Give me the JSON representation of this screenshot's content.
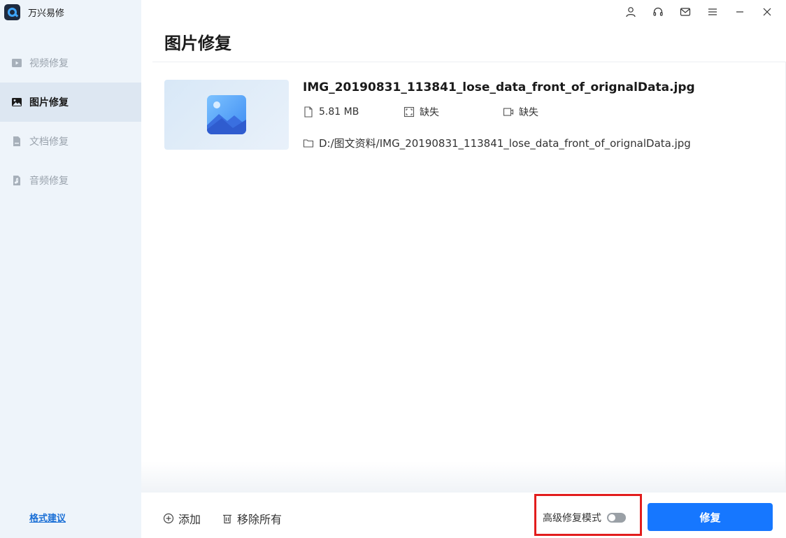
{
  "app": {
    "title": "万兴易修",
    "logo_icon": "app-logo-icon"
  },
  "sidebar": {
    "items": [
      {
        "label": "视频修复",
        "icon": "video-icon",
        "active": false
      },
      {
        "label": "图片修复",
        "icon": "image-icon",
        "active": true
      },
      {
        "label": "文档修复",
        "icon": "document-icon",
        "active": false
      },
      {
        "label": "音频修复",
        "icon": "audio-icon",
        "active": false
      }
    ],
    "format_link": "格式建议"
  },
  "titlebar": {
    "icons": [
      "user-icon",
      "headset-icon",
      "mail-icon",
      "menu-icon",
      "minimize-icon",
      "close-icon"
    ]
  },
  "page": {
    "title": "图片修复"
  },
  "file": {
    "name": "IMG_20190831_113841_lose_data_front_of_orignalData.jpg",
    "size": "5.81  MB",
    "resolution": "缺失",
    "camera": "缺失",
    "path": "D:/图文资料/IMG_20190831_113841_lose_data_front_of_orignalData.jpg"
  },
  "footer": {
    "add_label": "添加",
    "remove_all_label": "移除所有",
    "advanced_mode_label": "高级修复模式",
    "advanced_mode_on": false,
    "repair_label": "修复"
  },
  "colors": {
    "accent": "#1677ff",
    "sidebar_bg": "#eef4fa",
    "sidebar_active": "#dde7f2",
    "highlight": "#e21d1d"
  }
}
